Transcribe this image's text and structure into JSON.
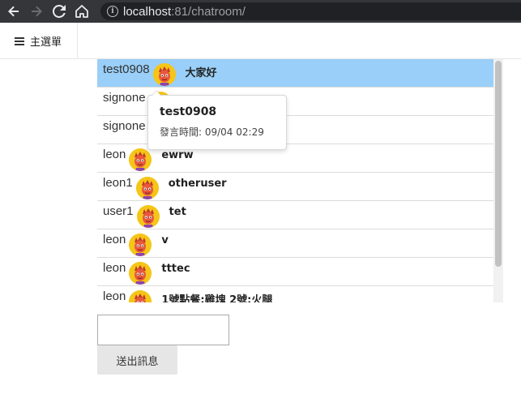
{
  "browser": {
    "url_host": "localhost",
    "url_rest": ":81/chatroom/"
  },
  "header": {
    "menu_label": "主選單"
  },
  "messages": [
    {
      "user": "test0908",
      "text": "大家好",
      "highlight": true
    },
    {
      "user": "signone",
      "text": ""
    },
    {
      "user": "signone",
      "text": ""
    },
    {
      "user": "leon",
      "text": "ewrw"
    },
    {
      "user": "leon1",
      "text": "otheruser"
    },
    {
      "user": "user1",
      "text": "tet"
    },
    {
      "user": "leon",
      "text": "v"
    },
    {
      "user": "leon",
      "text": "tttec"
    },
    {
      "user": "leon",
      "text": "1號點餐:雞塊 2號:火腿"
    }
  ],
  "tooltip": {
    "user": "test0908",
    "time": "發言時間: 09/04 02:29"
  },
  "composer": {
    "input_value": "",
    "send_label": "送出訊息"
  },
  "colors": {
    "highlight_row": "#99cff8",
    "avatar_bg": "#f5c518",
    "browser_bar": "#35363a"
  }
}
